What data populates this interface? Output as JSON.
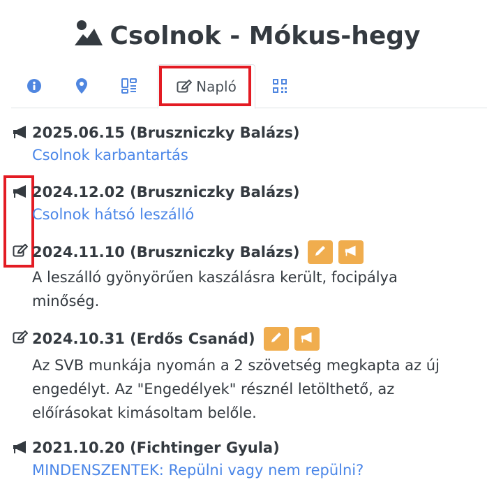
{
  "page": {
    "title": "Csolnok - Mókus-hegy",
    "title_icon": "mountain-icon"
  },
  "tabs": [
    {
      "name": "info",
      "icon": "info-circle-icon"
    },
    {
      "name": "location",
      "icon": "map-marker-icon"
    },
    {
      "name": "layout",
      "icon": "layout-grid-icon"
    },
    {
      "name": "log",
      "icon": "edit-icon",
      "label": "Napló",
      "active": true
    },
    {
      "name": "qr",
      "icon": "qr-code-icon"
    }
  ],
  "colors": {
    "accent_blue": "#4f86e0",
    "link_blue": "#4a86e8",
    "button_orange": "#f0ad4e",
    "highlight_red": "#e31b23",
    "text_dark": "#343a40"
  },
  "entries": [
    {
      "icon": "megaphone-icon",
      "header": "2025.06.15 (Bruszniczky Balázs)",
      "link": "Csolnok karbantartás"
    },
    {
      "icon": "megaphone-icon",
      "header": "2024.12.02 (Bruszniczky Balázs)",
      "link": "Csolnok hátsó leszálló"
    },
    {
      "icon": "edit-icon",
      "header": "2024.11.10 (Bruszniczky Balázs)",
      "buttons": [
        "pencil-icon",
        "megaphone-icon"
      ],
      "lines": [
        "A leszálló gyönyörűen kaszálásra került, focipálya",
        "minőség."
      ]
    },
    {
      "icon": "edit-icon",
      "header": "2024.10.31 (Erdős Csanád)",
      "buttons": [
        "pencil-icon",
        "megaphone-icon"
      ],
      "lines": [
        "Az SVB munkája nyomán a 2 szövetség megkapta az új",
        "engedélyt. Az \"Engedélyek\" résznél letölthető, az",
        "előírásokat kimásoltam belőle."
      ]
    },
    {
      "icon": "megaphone-icon",
      "header": "2021.10.20 (Fichtinger Gyula)",
      "link": "MINDENSZENTEK: Repülni vagy nem repülni?"
    }
  ]
}
